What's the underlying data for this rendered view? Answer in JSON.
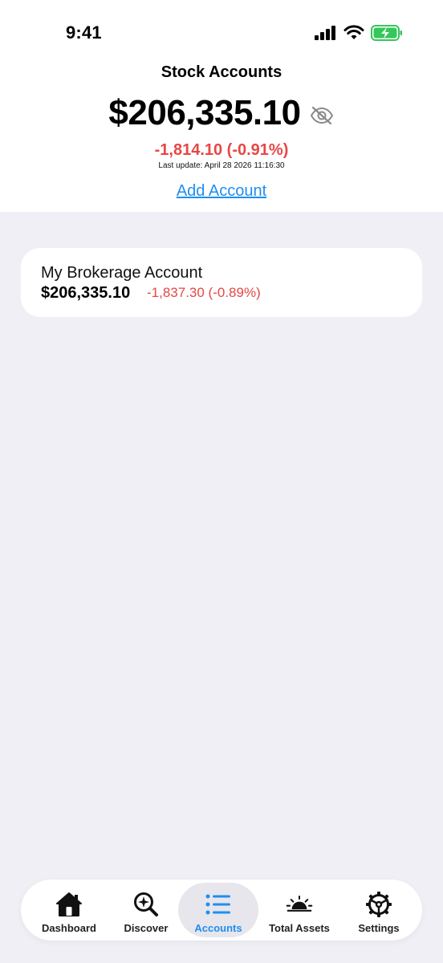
{
  "status_bar": {
    "time": "9:41"
  },
  "header": {
    "title": "Stock Accounts",
    "total_value": "$206,335.10",
    "change": "-1,814.10 (-0.91%)",
    "last_update": "Last update: April 28 2026 11:16:30",
    "add_account_label": "Add Account"
  },
  "accounts": [
    {
      "name": "My Brokerage Account",
      "value": "$206,335.10",
      "change": "-1,837.30 (-0.89%)"
    }
  ],
  "tabs": [
    {
      "label": "Dashboard",
      "icon": "house-icon"
    },
    {
      "label": "Discover",
      "icon": "magnifier-sparkle-icon"
    },
    {
      "label": "Accounts",
      "icon": "list-icon",
      "active": true
    },
    {
      "label": "Total Assets",
      "icon": "sunrise-icon"
    },
    {
      "label": "Settings",
      "icon": "gear-icon"
    }
  ],
  "colors": {
    "accent": "#1f8ef1",
    "negative": "#e84646",
    "background": "#f0eff5",
    "battery": "#34c759"
  }
}
